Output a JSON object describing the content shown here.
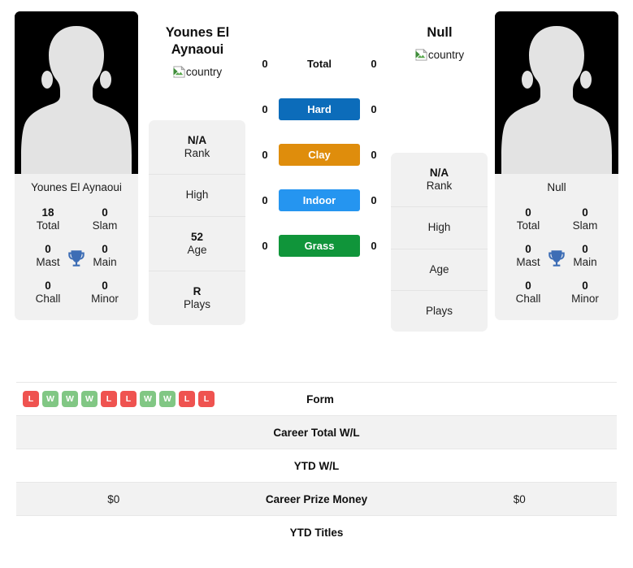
{
  "players": {
    "left": {
      "name": "Younes El Aynaoui",
      "name_line1": "Younes El",
      "name_line2": "Aynaoui",
      "country_alt": "country",
      "photo_caption": "Younes El Aynaoui",
      "titles": [
        {
          "value": "18",
          "label": "Total"
        },
        {
          "value": "0",
          "label": "Slam"
        },
        {
          "value": "0",
          "label": "Mast"
        },
        {
          "value": "0",
          "label": "Main"
        },
        {
          "value": "0",
          "label": "Chall"
        },
        {
          "value": "0",
          "label": "Minor"
        }
      ],
      "info": [
        {
          "value": "N/A",
          "label": "Rank"
        },
        {
          "value": "",
          "label": "High"
        },
        {
          "value": "52",
          "label": "Age"
        },
        {
          "value": "R",
          "label": "Plays"
        }
      ],
      "h2h": {
        "total": "0",
        "hard": "0",
        "clay": "0",
        "indoor": "0",
        "grass": "0"
      },
      "form": [
        "L",
        "W",
        "W",
        "W",
        "L",
        "L",
        "W",
        "W",
        "L",
        "L"
      ],
      "career_total_wl": "",
      "ytd_wl": "",
      "career_prize_money": "$0",
      "ytd_titles": ""
    },
    "right": {
      "name": "Null",
      "country_alt": "country",
      "photo_caption": "Null",
      "titles": [
        {
          "value": "0",
          "label": "Total"
        },
        {
          "value": "0",
          "label": "Slam"
        },
        {
          "value": "0",
          "label": "Mast"
        },
        {
          "value": "0",
          "label": "Main"
        },
        {
          "value": "0",
          "label": "Chall"
        },
        {
          "value": "0",
          "label": "Minor"
        }
      ],
      "info": [
        {
          "value": "N/A",
          "label": "Rank"
        },
        {
          "value": "",
          "label": "High"
        },
        {
          "value": "",
          "label": "Age"
        },
        {
          "value": "",
          "label": "Plays"
        }
      ],
      "h2h": {
        "total": "0",
        "hard": "0",
        "clay": "0",
        "indoor": "0",
        "grass": "0"
      },
      "form": [],
      "career_total_wl": "",
      "ytd_wl": "",
      "career_prize_money": "$0",
      "ytd_titles": ""
    }
  },
  "surfaces": [
    {
      "key": "total",
      "label": "Total",
      "pill": false,
      "color": ""
    },
    {
      "key": "hard",
      "label": "Hard",
      "pill": true,
      "color": "#0c6cba"
    },
    {
      "key": "clay",
      "label": "Clay",
      "pill": true,
      "color": "#df8d0c"
    },
    {
      "key": "indoor",
      "label": "Indoor",
      "pill": true,
      "color": "#2595f0"
    },
    {
      "key": "grass",
      "label": "Grass",
      "pill": true,
      "color": "#10953a"
    }
  ],
  "table_rows": [
    {
      "key": "form",
      "label": "Form"
    },
    {
      "key": "career_total_wl",
      "label": "Career Total W/L"
    },
    {
      "key": "ytd_wl",
      "label": "YTD W/L"
    },
    {
      "key": "career_prize_money",
      "label": "Career Prize Money"
    },
    {
      "key": "ytd_titles",
      "label": "YTD Titles"
    }
  ],
  "colors": {
    "win_badge": "#81c784",
    "loss_badge": "#ef5350",
    "card_bg": "#f1f1f1",
    "row_shaded": "#f2f2f2"
  }
}
